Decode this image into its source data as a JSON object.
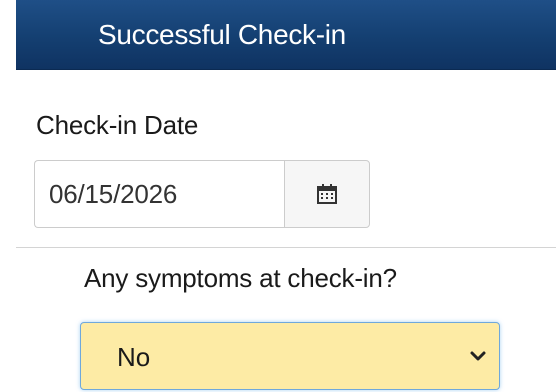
{
  "header": {
    "title": "Successful Check-in"
  },
  "checkin_date": {
    "label": "Check-in Date",
    "value": "06/15/2026",
    "calendar_icon": "calendar-icon"
  },
  "symptoms": {
    "label": "Any symptoms at check-in?",
    "selected": "No",
    "chevron_icon": "chevron-down-icon",
    "background_color": "#fdeba5"
  },
  "colors": {
    "header": "#143f71",
    "focus_border": "#6fa8dc"
  }
}
